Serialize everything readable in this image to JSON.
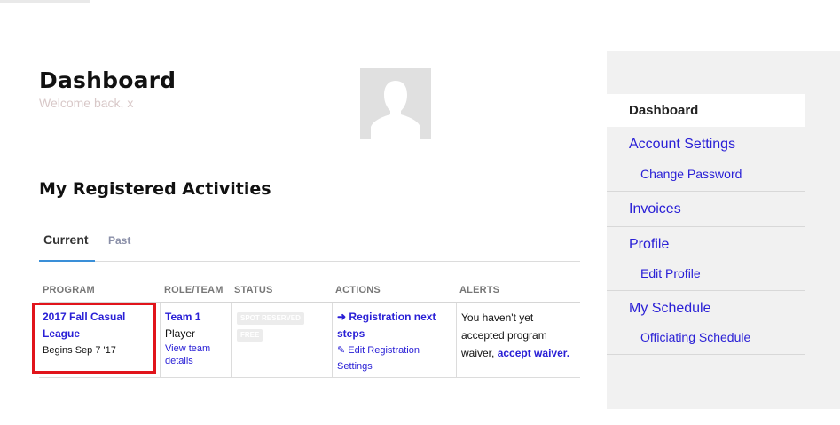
{
  "header": {
    "title": "Dashboard",
    "welcome": "Welcome back, x"
  },
  "activities": {
    "title": "My Registered Activities",
    "tabs": [
      {
        "label": "Current",
        "active": true
      },
      {
        "label": "Past",
        "active": false
      }
    ],
    "columns": [
      "PROGRAM",
      "ROLE/TEAM",
      "STATUS",
      "ACTIONS",
      "ALERTS"
    ],
    "rows": [
      {
        "program_name_line1": "2017 Fall Casual",
        "program_name_line2": "League",
        "program_date": "Begins Sep 7 '17",
        "team": "Team 1",
        "role": "Player",
        "view_team_line1": "View team",
        "view_team_line2": "details",
        "status_badges": [
          "SPOT RESERVED",
          "FREE"
        ],
        "action_primary_line1": "Registration next",
        "action_primary_line2": "steps",
        "action_secondary_line1": "Edit Registration",
        "action_secondary_line2": "Settings",
        "alert_line1": "You haven't yet",
        "alert_line2": "accepted program",
        "alert_line3": "waiver,",
        "alert_link": "accept waiver."
      }
    ]
  },
  "sidebar": {
    "active": "Dashboard",
    "items": [
      {
        "label": "Account Settings",
        "sub": "Change Password"
      },
      {
        "label": "Invoices"
      },
      {
        "label": "Profile",
        "sub": "Edit Profile"
      },
      {
        "label": "My Schedule",
        "sub": "Officiating Schedule"
      }
    ]
  },
  "colors": {
    "link": "#2a20d6",
    "tab_underline": "#3a8fd8",
    "highlight_box": "#e1141b",
    "sidebar_bg": "#f1f1f1"
  },
  "icons": {
    "avatar": "user-silhouette-icon",
    "action_arrow": "arrow-right-icon",
    "edit": "edit-icon"
  }
}
